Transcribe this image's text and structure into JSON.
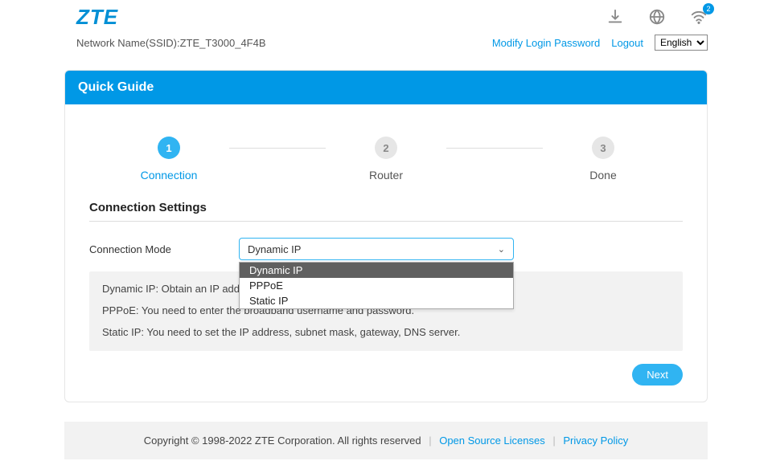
{
  "brand": "ZTE",
  "ssid_label": "Network Name(SSID):",
  "ssid_value": "ZTE_T3000_4F4B",
  "wifi_badge": "2",
  "modify_pw": "Modify Login Password",
  "logout": "Logout",
  "lang": "English",
  "panel_title": "Quick Guide",
  "steps": {
    "s1": {
      "num": "1",
      "label": "Connection"
    },
    "s2": {
      "num": "2",
      "label": "Router"
    },
    "s3": {
      "num": "3",
      "label": "Done"
    }
  },
  "section_title": "Connection Settings",
  "form": {
    "mode_label": "Connection Mode",
    "mode_value": "Dynamic IP",
    "options": {
      "o1": "Dynamic IP",
      "o2": "PPPoE",
      "o3": "Static IP"
    }
  },
  "info": {
    "l1": "Dynamic IP: Obtain an IP address dynamically from ISP.",
    "l2": "PPPoE: You need to enter the broadband username and password.",
    "l3": "Static IP: You need to set the IP address, subnet mask, gateway, DNS server."
  },
  "next_btn": "Next",
  "footer": {
    "copyright": "Copyright © 1998-2022 ZTE Corporation. All rights reserved",
    "osl": "Open Source Licenses",
    "pp": "Privacy Policy"
  }
}
